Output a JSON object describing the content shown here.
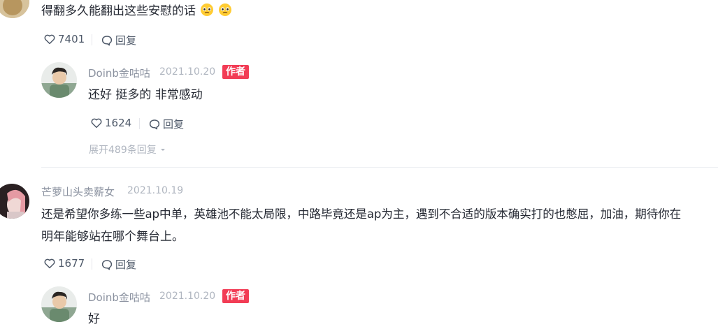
{
  "comments": [
    {
      "text": "得翻多久能翻出这些安慰的话",
      "likes": "7401",
      "reply_label": "回复",
      "emoji_icon": "pleading-face-emoji",
      "reply": {
        "author": "Doinb金咕咕",
        "date": "2021.10.20",
        "badge": "作者",
        "text": "还好 挺多的 非常感动",
        "likes": "1624",
        "reply_label": "回复",
        "expand": "展开489条回复"
      }
    },
    {
      "author": "芒萝山头卖薪女",
      "date": "2021.10.19",
      "text_line1": "还是希望你多练一些ap中单，英雄池不能太局限，中路毕竟还是ap为主，遇到不合适的版本确实打的也憋屈，加油，期待你在",
      "text_line2": "明年能够站在哪个舞台上。",
      "likes": "1677",
      "reply_label": "回复",
      "reply": {
        "author": "Doinb金咕咕",
        "date": "2021.10.20",
        "badge": "作者",
        "text": "好"
      }
    }
  ],
  "colors": {
    "badge": "#f23c55",
    "meta": "#8a919f",
    "text": "#252933"
  }
}
